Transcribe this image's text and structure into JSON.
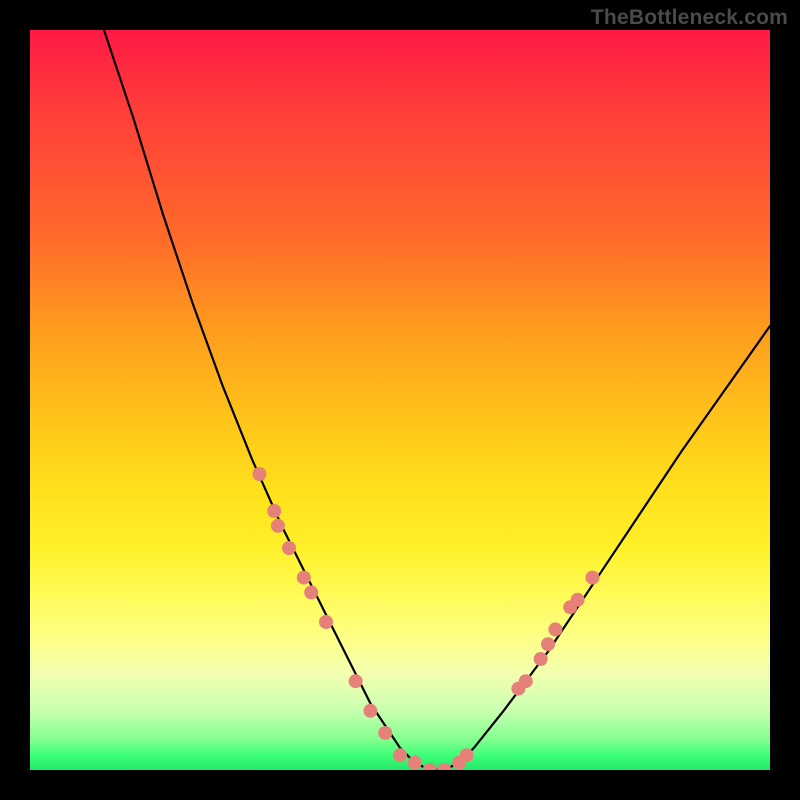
{
  "attribution": "TheBottleneck.com",
  "chart_data": {
    "type": "line",
    "title": "",
    "xlabel": "",
    "ylabel": "",
    "xlim": [
      0,
      100
    ],
    "ylim": [
      0,
      100
    ],
    "series": [
      {
        "name": "curve",
        "x": [
          10,
          14,
          18,
          22,
          26,
          30,
          34,
          36,
          38,
          40,
          42,
          44,
          46,
          48,
          50,
          52,
          54,
          56,
          58,
          60,
          64,
          70,
          78,
          88,
          100
        ],
        "y": [
          100,
          88,
          75,
          63,
          52,
          42,
          33,
          29,
          25,
          21,
          17,
          13,
          9,
          6,
          3,
          1,
          0,
          0,
          1,
          3,
          8,
          16,
          28,
          43,
          60
        ]
      }
    ],
    "markers": [
      {
        "x": 31,
        "y": 40
      },
      {
        "x": 33,
        "y": 35
      },
      {
        "x": 33.5,
        "y": 33
      },
      {
        "x": 35,
        "y": 30
      },
      {
        "x": 37,
        "y": 26
      },
      {
        "x": 38,
        "y": 24
      },
      {
        "x": 40,
        "y": 20
      },
      {
        "x": 44,
        "y": 12
      },
      {
        "x": 46,
        "y": 8
      },
      {
        "x": 48,
        "y": 5
      },
      {
        "x": 50,
        "y": 2
      },
      {
        "x": 52,
        "y": 1
      },
      {
        "x": 54,
        "y": 0
      },
      {
        "x": 56,
        "y": 0
      },
      {
        "x": 58,
        "y": 1
      },
      {
        "x": 59,
        "y": 2
      },
      {
        "x": 66,
        "y": 11
      },
      {
        "x": 67,
        "y": 12
      },
      {
        "x": 69,
        "y": 15
      },
      {
        "x": 70,
        "y": 17
      },
      {
        "x": 71,
        "y": 19
      },
      {
        "x": 73,
        "y": 22
      },
      {
        "x": 74,
        "y": 23
      },
      {
        "x": 76,
        "y": 26
      }
    ],
    "marker_color": "#e6817a",
    "curve_color": "#000000"
  }
}
